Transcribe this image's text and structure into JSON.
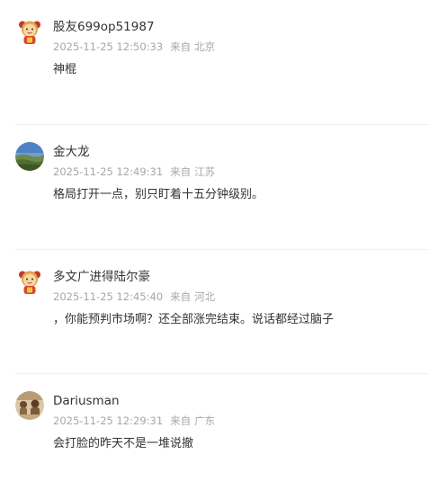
{
  "comments": [
    {
      "username": "股友699op51987",
      "time": "2025-11-25 12:50:33",
      "from_label": "来自",
      "location": "北京",
      "content": "神棍",
      "avatar_icon": "default-mascot-avatar"
    },
    {
      "username": "金大龙",
      "time": "2025-11-25 12:49:31",
      "from_label": "来自",
      "location": "江苏",
      "content": "格局打开一点，别只盯着十五分钟级别。",
      "avatar_icon": "landscape-photo-avatar"
    },
    {
      "username": "多文广进得陆尔豪",
      "time": "2025-11-25 12:45:40",
      "from_label": "来自",
      "location": "河北",
      "content": "，你能预判市场啊？还全部涨完结束。说话都经过脑子",
      "avatar_icon": "default-mascot-avatar"
    },
    {
      "username": "Dariusman",
      "time": "2025-11-25 12:29:31",
      "from_label": "来自",
      "location": "广东",
      "content": "会打脸的昨天不是一堆说撤",
      "avatar_icon": "photo-avatar"
    }
  ]
}
